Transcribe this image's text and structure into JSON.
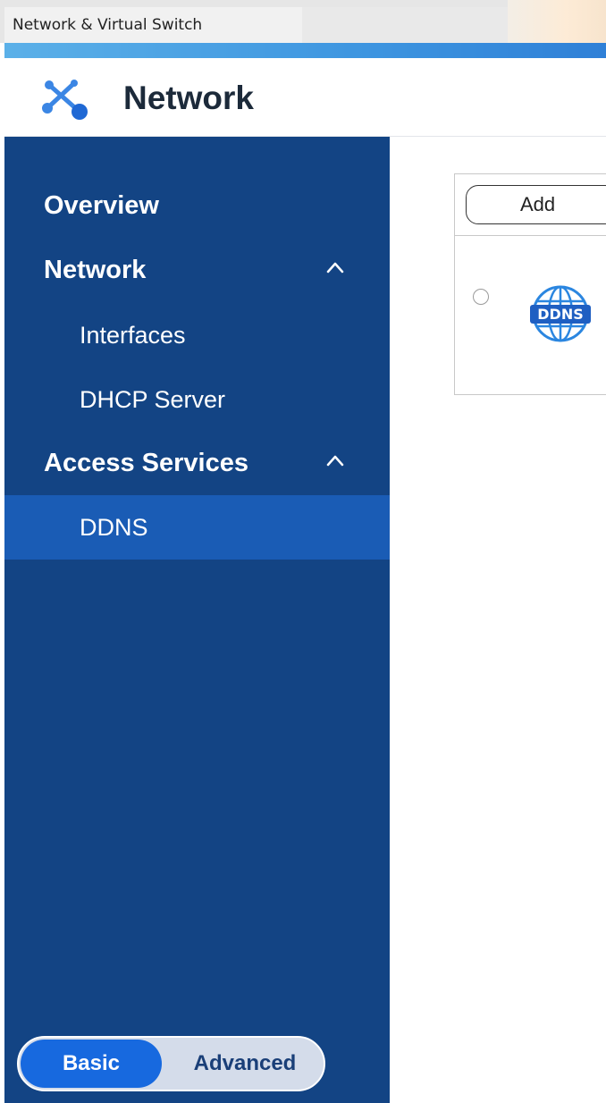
{
  "window": {
    "title": "Network & Virtual Switch"
  },
  "header": {
    "title": "Network",
    "logo_icon": "network-node-icon"
  },
  "sidebar": {
    "items": [
      {
        "label": "Overview"
      },
      {
        "label": "Network",
        "expanded": true
      },
      {
        "label": "Interfaces"
      },
      {
        "label": "DHCP Server"
      },
      {
        "label": "Access Services",
        "expanded": true
      },
      {
        "label": "DDNS",
        "selected": true
      }
    ]
  },
  "mode_toggle": {
    "basic_label": "Basic",
    "advanced_label": "Advanced",
    "selected": "Basic"
  },
  "main": {
    "add_label": "Add",
    "row_icon": "ddns-globe-icon",
    "row_icon_text": "DDNS"
  },
  "colors": {
    "sidebar_bg": "#134484",
    "sidebar_active": "#1a5cb5",
    "accent_blue": "#1769df"
  }
}
